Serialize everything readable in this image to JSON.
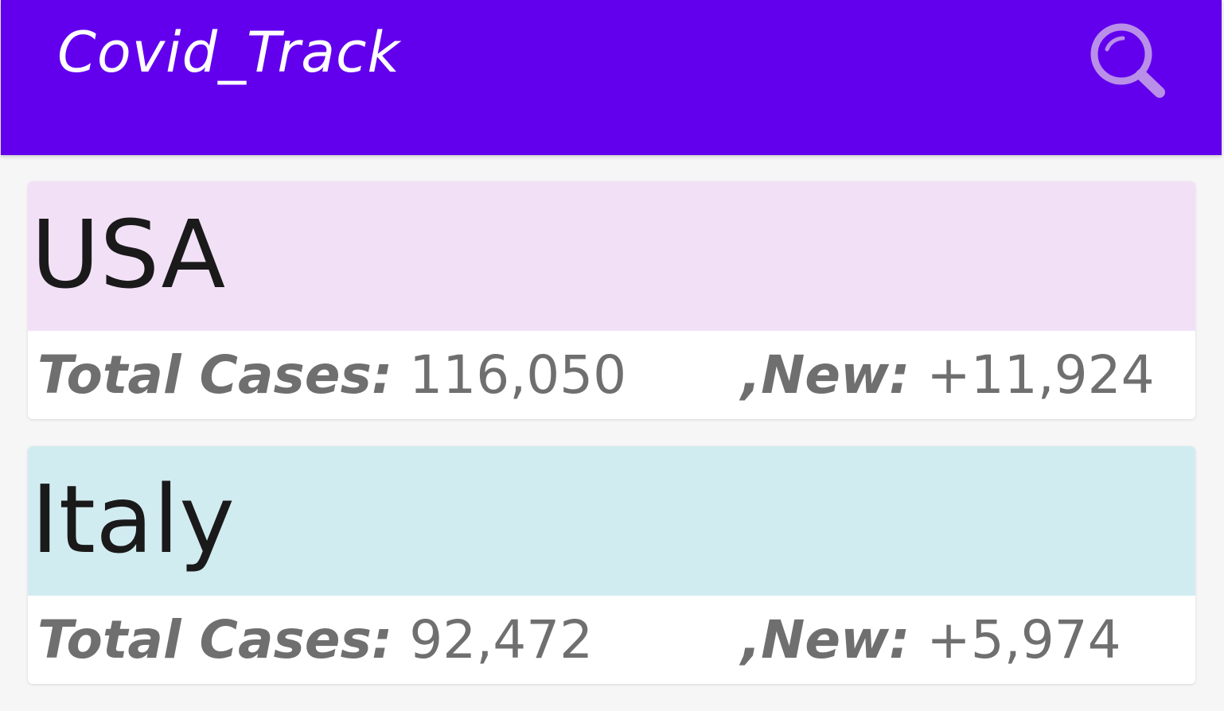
{
  "app_bar": {
    "title": "Covid_Track",
    "background": "#6200ee",
    "search_icon": "search-icon"
  },
  "countries": [
    {
      "name": "USA",
      "color": "#f2e1f6",
      "total_label": "Total Cases:",
      "total_value": "116,050",
      "new_label": ",New:",
      "new_value": "+11,924"
    },
    {
      "name": "Italy",
      "color": "#d1ecf0",
      "total_label": "Total Cases:",
      "total_value": "92,472",
      "new_label": ",New:",
      "new_value": "+5,974"
    }
  ]
}
